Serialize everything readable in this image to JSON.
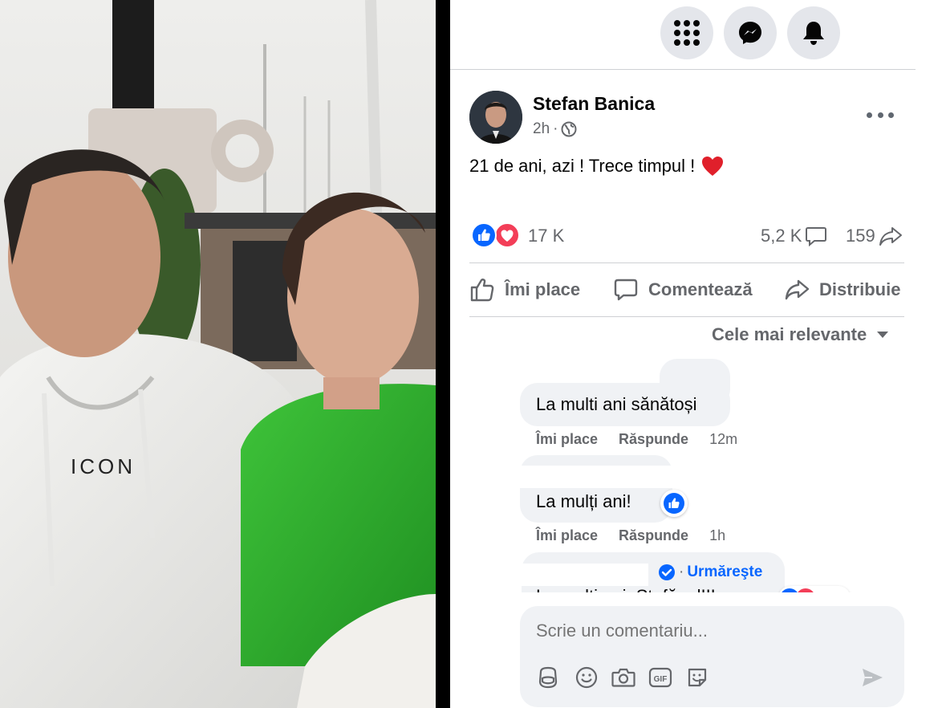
{
  "nav": {
    "icons": [
      "apps-grid-icon",
      "messenger-icon",
      "notifications-bell-icon"
    ]
  },
  "post": {
    "author": "Stefan Banica",
    "time": "2h",
    "separator": "·",
    "privacy_icon": "globe-icon",
    "text": "21 de ani, azi ! Trece timpul !",
    "emoji": "❤️",
    "reactions": {
      "icons": [
        "like-icon",
        "love-icon"
      ],
      "count": "17 K"
    },
    "comments_count": "5,2 K",
    "shares_count": "159"
  },
  "actions": {
    "like": "Îmi place",
    "comment": "Comentează",
    "share": "Distribuie"
  },
  "sort": {
    "label": "Cele mai relevante"
  },
  "comments": [
    {
      "text": "La multi ani sănătoși",
      "like": "Îmi place",
      "reply": "Răspunde",
      "time": "12m"
    },
    {
      "text": "La mulți ani!",
      "like": "Îmi place",
      "reply": "Răspunde",
      "time": "1h",
      "reaction": "like-icon"
    },
    {
      "follow": "Urmăreşte",
      "separator": "·",
      "text": "La multi ani, Stefănel!!!"
    }
  ],
  "composer": {
    "placeholder": "Scrie un comentariu...",
    "icons": [
      "avatar-sticker-icon",
      "emoji-icon",
      "camera-icon",
      "gif-icon",
      "sticker-icon",
      "send-icon"
    ],
    "gif_label": "GIF"
  },
  "colors": {
    "brand": "#0866ff",
    "love": "#f33e58",
    "muted": "#65676b",
    "bubble": "#f0f2f5"
  }
}
